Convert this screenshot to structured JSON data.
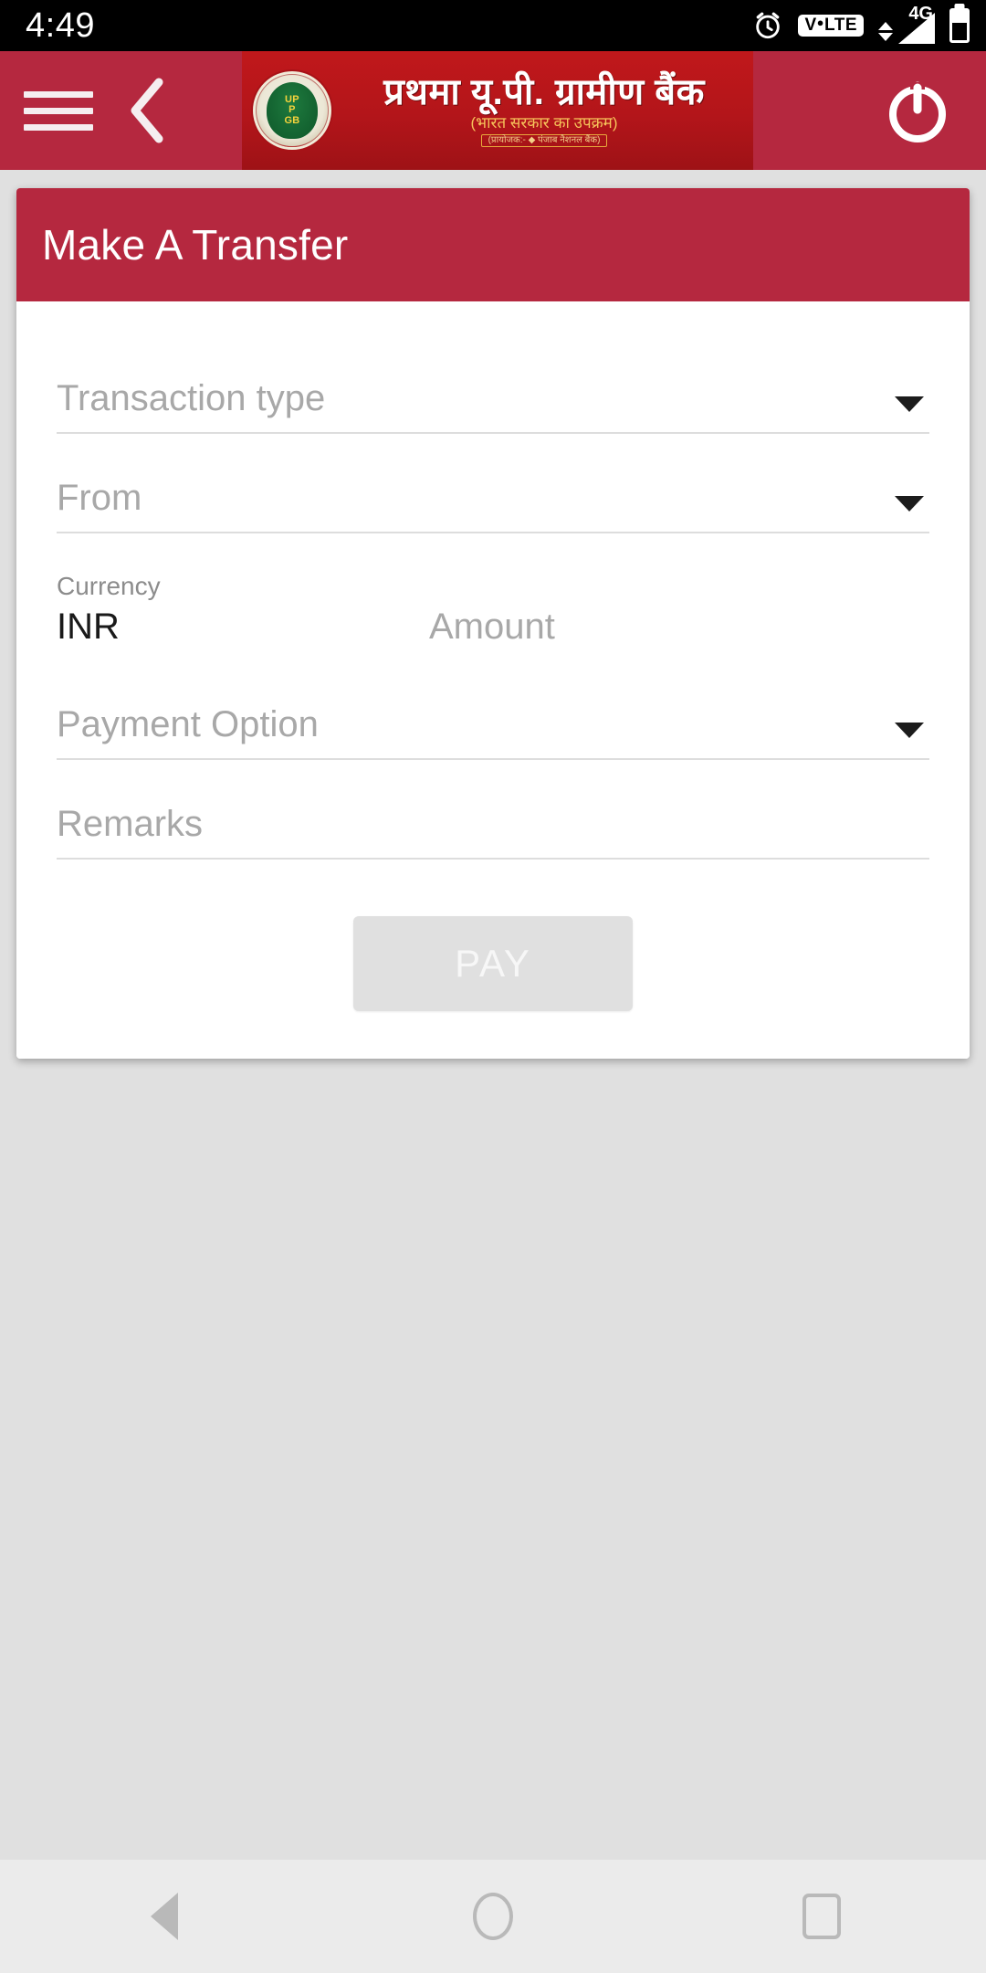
{
  "status_bar": {
    "clock": "4:49",
    "icons": [
      {
        "name": "alarm-icon",
        "label": "alarm"
      },
      {
        "name": "volte-icon",
        "label": "VoLTE"
      },
      {
        "name": "signal-icon",
        "label": "4G"
      },
      {
        "name": "battery-icon",
        "label": "battery"
      }
    ],
    "volte_text_1": "V",
    "volte_text_2": "LTE",
    "network_generation": "4G"
  },
  "app_bar": {
    "menu_icon": "hamburger-menu-icon",
    "back_icon": "chevron-left-icon",
    "power_icon": "power-logout-icon",
    "logo": {
      "name_main": "प्रथमा यू.पी. ग्रामीण बैंक",
      "name_sub": "(भारत सरकार का उपक्रम)",
      "sponsor": "(प्रायोजक:- ◆ पंजाब नैशनल बैंक)",
      "seal_initials": "UP\nP\nGB"
    }
  },
  "card": {
    "title": "Make A Transfer"
  },
  "form": {
    "transaction_type": {
      "placeholder": "Transaction type",
      "value": "",
      "caret_icon": "chevron-down-icon"
    },
    "from": {
      "placeholder": "From",
      "value": "",
      "caret_icon": "chevron-down-icon"
    },
    "currency": {
      "label": "Currency",
      "value": "INR"
    },
    "amount": {
      "placeholder": "Amount",
      "value": ""
    },
    "payment_option": {
      "placeholder": "Payment Option",
      "value": "",
      "caret_icon": "chevron-down-icon"
    },
    "remarks": {
      "placeholder": "Remarks",
      "value": ""
    },
    "pay_button": {
      "label": "PAY",
      "enabled": false
    }
  },
  "nav_bar": {
    "back_label": "Back",
    "home_label": "Home",
    "recents_label": "Recents"
  },
  "colors": {
    "brand_red": "#b5283f",
    "logo_red": "#b3151a",
    "page_background": "#e0e0e0",
    "card_background": "#ffffff",
    "placeholder_text": "#a8a8a8",
    "disabled_button": "#e0e0e0"
  }
}
